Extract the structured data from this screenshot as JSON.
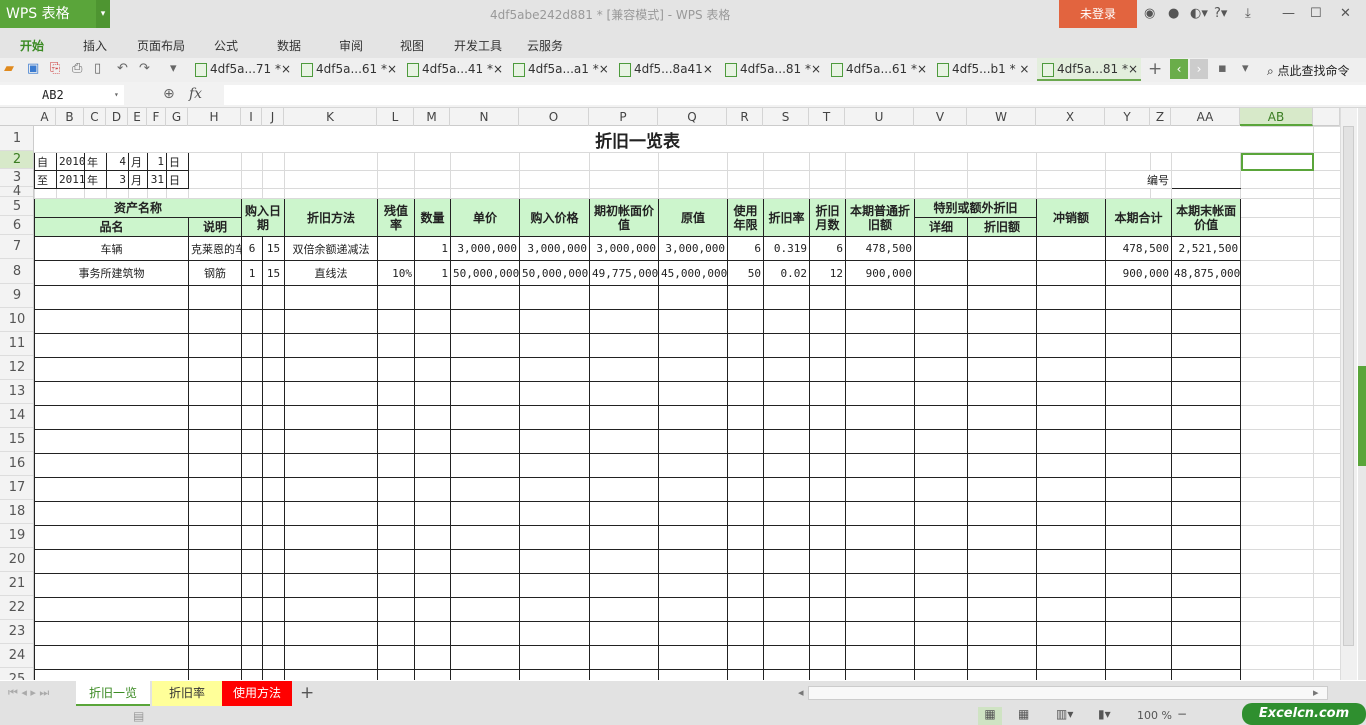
{
  "app": {
    "logo": "WPS 表格",
    "title": "4df5abe242d881 * [兼容模式] - WPS 表格",
    "login": "未登录",
    "search_cmd": "点此查找命令"
  },
  "menu": [
    "开始",
    "插入",
    "页面布局",
    "公式",
    "数据",
    "审阅",
    "视图",
    "开发工具",
    "云服务"
  ],
  "doc_tabs": [
    "4df5a...71 *×",
    "4df5a...61 *×",
    "4df5a...41 *×",
    "4df5a...a1 *×",
    "4df5...8a41×",
    "4df5a...81 *×",
    "4df5a...61 *×",
    "4df5...b1 * ×",
    "4df5a...81 *×"
  ],
  "formula_bar": {
    "name_box": "AB2",
    "fx": "fx",
    "value": ""
  },
  "columns": [
    "A",
    "B",
    "C",
    "D",
    "E",
    "F",
    "G",
    "H",
    "I",
    "J",
    "K",
    "L",
    "M",
    "N",
    "O",
    "P",
    "Q",
    "R",
    "S",
    "T",
    "U",
    "V",
    "W",
    "X",
    "Y",
    "Z",
    "AA",
    "AB"
  ],
  "selected_cell": "AB2",
  "sheet": {
    "title": "折旧一览表",
    "period_from": [
      "自",
      "2010",
      "年",
      "4",
      "月",
      "1",
      "日"
    ],
    "period_to": [
      "至",
      "2011",
      "年",
      "3",
      "月",
      "31",
      "日"
    ],
    "number_label": "编号",
    "header": {
      "asset_name": "资产名称",
      "item": "品名",
      "desc": "说明",
      "purchase_date": "购入日期",
      "method": "折旧方法",
      "residual": "残值率",
      "qty": "数量",
      "unit_price": "单价",
      "purchase_price": "购入价格",
      "opening": "期初帐面价值",
      "original": "原值",
      "life": "使用年限",
      "rate": "折旧率",
      "months": "折旧月数",
      "normal_dep": "本期普通折旧额",
      "special": "特别或额外折旧",
      "special_detail": "详细",
      "special_dep": "折旧额",
      "writeoff": "冲销额",
      "total": "本期合计",
      "closing": "本期末帐面价值"
    },
    "assets": [
      {
        "item": "车辆",
        "desc": "克莱恩的车",
        "month": "6",
        "day": "15",
        "method": "双倍余额递减法",
        "residual": "",
        "qty": "1",
        "unit_price": "3,000,000",
        "purchase_price": "3,000,000",
        "opening": "3,000,000",
        "original": "3,000,000",
        "life": "6",
        "rate": "0.319",
        "months": "6",
        "normal_dep": "478,500",
        "special_detail": "",
        "special_dep": "",
        "writeoff": "",
        "total": "478,500",
        "closing": "2,521,500"
      },
      {
        "item": "事务所建筑物",
        "desc": "钢筋",
        "month": "1",
        "day": "15",
        "method": "直线法",
        "residual": "10%",
        "qty": "1",
        "unit_price": "50,000,000",
        "purchase_price": "50,000,000",
        "opening": "49,775,000",
        "original": "45,000,000",
        "life": "50",
        "rate": "0.02",
        "months": "12",
        "normal_dep": "900,000",
        "special_detail": "",
        "special_dep": "",
        "writeoff": "",
        "total": "900,000",
        "closing": "48,875,000"
      }
    ]
  },
  "sheet_tabs": [
    {
      "label": "折旧一览",
      "color": "#ffffff",
      "text": "#3a8a22"
    },
    {
      "label": "折旧率",
      "color": "#ffff99",
      "text": "#333333"
    },
    {
      "label": "使用方法",
      "color": "#ff0000",
      "text": "#ffffff"
    }
  ],
  "status": {
    "zoom": "100 %",
    "watermark": "Excelcn.com"
  }
}
